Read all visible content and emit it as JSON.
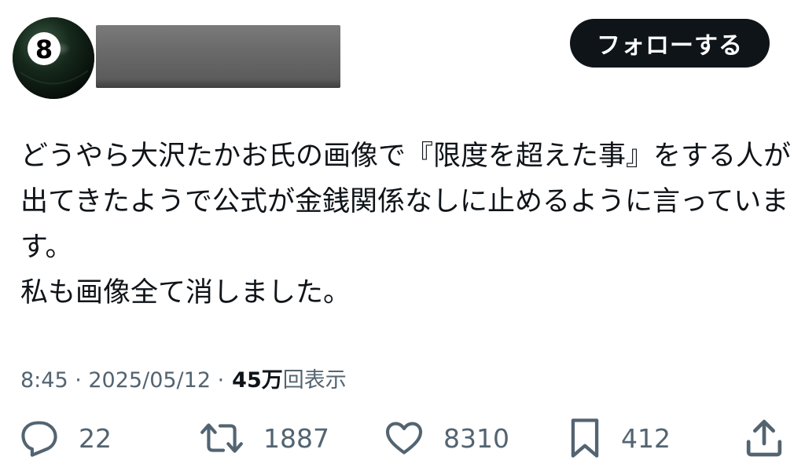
{
  "header": {
    "follow_label": "フォローする"
  },
  "tweet": {
    "lines": [
      "どうやら大沢たかお氏の画像で『限度を超えた事』をする人が",
      "出てきたようで公式が金銭関係なしに止めるように言っていま",
      "す。",
      "私も画像全て消しました。"
    ]
  },
  "meta": {
    "timestamp": "8:45 · 2025/05/12 ·",
    "views_count": "45万",
    "views_label": "回表示"
  },
  "actions": {
    "reply_count": "22",
    "retweet_count": "1887",
    "like_count": "8310",
    "bookmark_count": "412"
  },
  "icons": {
    "reply": "speech-bubble-icon",
    "retweet": "retweet-arrows-icon",
    "like": "heart-icon",
    "bookmark": "bookmark-icon",
    "share": "share-upload-icon"
  },
  "colors": {
    "text": "#0f1419",
    "secondary": "#536471",
    "button_bg": "#0f1419",
    "button_text": "#ffffff"
  }
}
